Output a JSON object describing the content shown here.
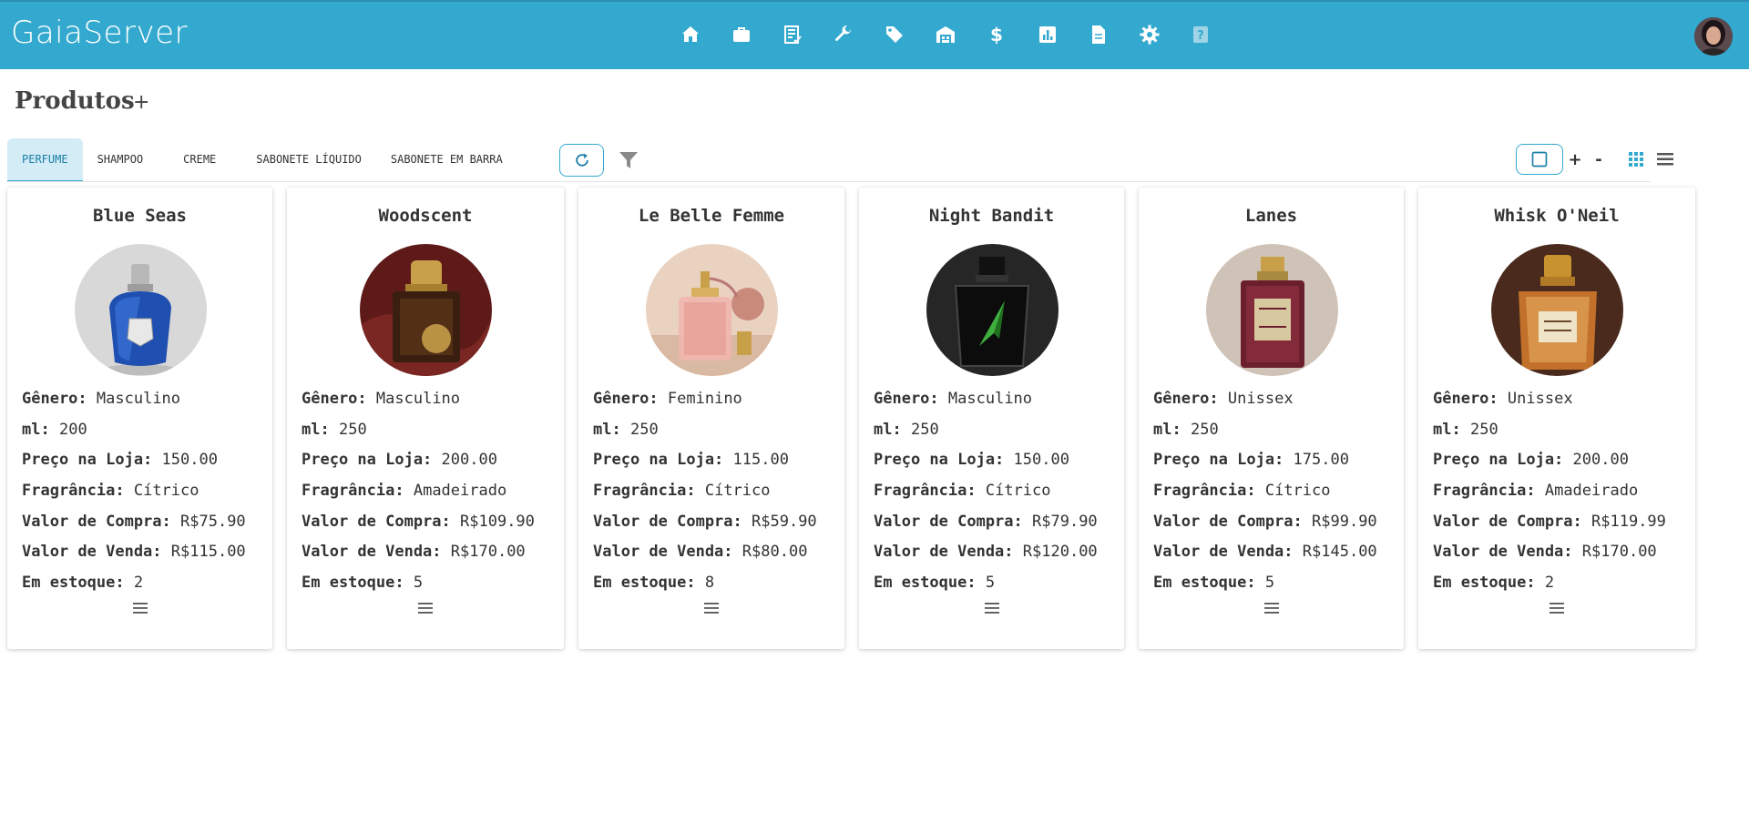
{
  "app": {
    "title": "GaiaServer"
  },
  "nav": {
    "icons": [
      "home-icon",
      "briefcase-icon",
      "receipt-icon",
      "wrench-icon",
      "tag-icon",
      "warehouse-icon",
      "dollar-icon",
      "chart-icon",
      "document-icon",
      "gear-icon",
      "help-icon"
    ]
  },
  "page": {
    "title": "Produtos",
    "add_label": "+"
  },
  "tabs": [
    {
      "label": "PERFUME",
      "active": true
    },
    {
      "label": "SHAMPOO",
      "active": false
    },
    {
      "label": "CREME",
      "active": false
    },
    {
      "label": "SABONETE LÍQUIDO",
      "active": false
    },
    {
      "label": "SABONETE EM BARRA",
      "active": false
    }
  ],
  "toolbar": {
    "zoom_in": "+",
    "zoom_out": "-"
  },
  "labels": {
    "genero": "Gênero:",
    "ml": "ml:",
    "preco": "Preço na Loja:",
    "fragrancia": "Fragrância:",
    "compra": "Valor de Compra:",
    "venda": "Valor de Venda:",
    "estoque": "Em estoque:"
  },
  "products": [
    {
      "name": "Blue Seas",
      "genero": "Masculino",
      "ml": "200",
      "preco": "150.00",
      "fragrancia": "Cítrico",
      "compra": "R$75.90",
      "venda": "R$115.00",
      "estoque": "2"
    },
    {
      "name": "Woodscent",
      "genero": "Masculino",
      "ml": "250",
      "preco": "200.00",
      "fragrancia": "Amadeirado",
      "compra": "R$109.90",
      "venda": "R$170.00",
      "estoque": "5"
    },
    {
      "name": "Le Belle Femme",
      "genero": "Feminino",
      "ml": "250",
      "preco": "115.00",
      "fragrancia": "Cítrico",
      "compra": "R$59.90",
      "venda": "R$80.00",
      "estoque": "8"
    },
    {
      "name": "Night Bandit",
      "genero": "Masculino",
      "ml": "250",
      "preco": "150.00",
      "fragrancia": "Cítrico",
      "compra": "R$79.90",
      "venda": "R$120.00",
      "estoque": "5"
    },
    {
      "name": "Lanes",
      "genero": "Unissex",
      "ml": "250",
      "preco": "175.00",
      "fragrancia": "Cítrico",
      "compra": "R$99.90",
      "venda": "R$145.00",
      "estoque": "5"
    },
    {
      "name": "Whisk O'Neil",
      "genero": "Unissex",
      "ml": "250",
      "preco": "200.00",
      "fragrancia": "Amadeirado",
      "compra": "R$119.99",
      "venda": "R$170.00",
      "estoque": "2"
    }
  ],
  "colors": {
    "header": "#34a9cf",
    "accent": "#1b7ea8",
    "active_tab": "#d3ecf5"
  }
}
